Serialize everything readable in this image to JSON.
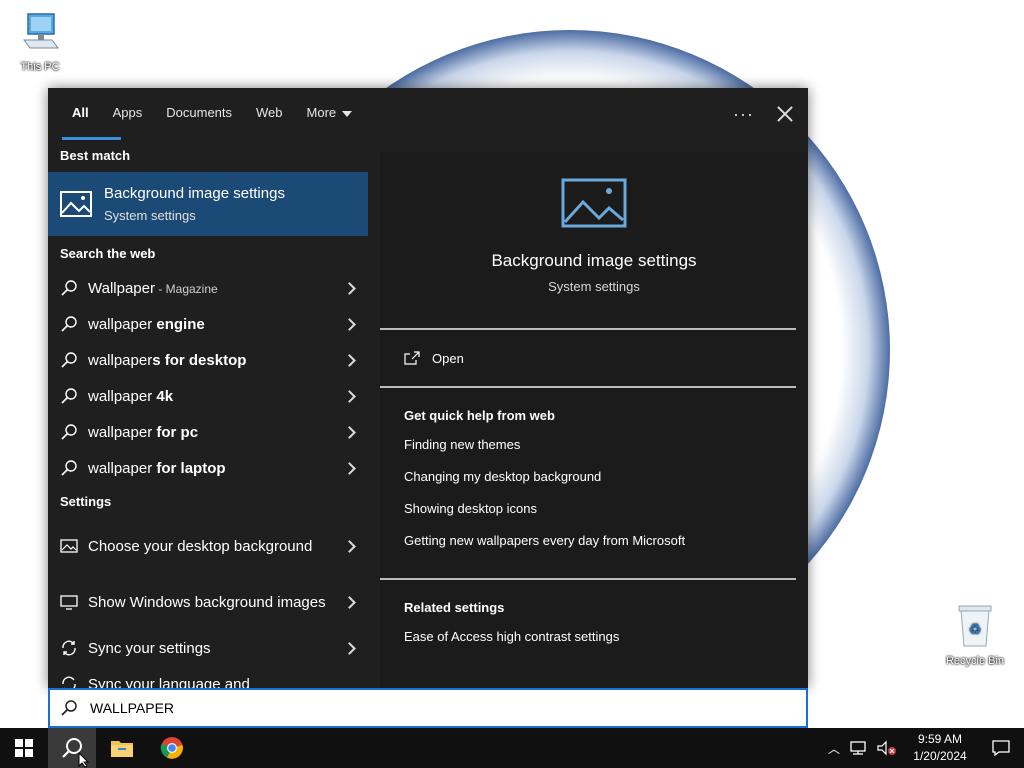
{
  "desktop": {
    "this_pc_label": "This PC",
    "recycle_bin_label": "Recycle Bin"
  },
  "search_panel": {
    "tabs": [
      "All",
      "Apps",
      "Documents",
      "Web",
      "More"
    ],
    "best_match_header": "Best match",
    "best_match": {
      "title": "Background image settings",
      "subtitle": "System settings"
    },
    "web_header": "Search the web",
    "web_results": [
      {
        "prefix": "Wallpaper",
        "bold": "",
        "sub": " - Magazine"
      },
      {
        "prefix": "wallpaper ",
        "bold": "engine",
        "sub": ""
      },
      {
        "prefix": "wallpaper",
        "bold": "s for desktop",
        "sub": ""
      },
      {
        "prefix": "wallpaper ",
        "bold": "4k",
        "sub": ""
      },
      {
        "prefix": "wallpaper ",
        "bold": "for pc",
        "sub": ""
      },
      {
        "prefix": "wallpaper ",
        "bold": "for laptop",
        "sub": ""
      }
    ],
    "settings_header": "Settings",
    "settings_results": [
      "Choose your desktop background",
      "Show Windows background images",
      "Sync your settings",
      "Sync your language and"
    ],
    "preview": {
      "title": "Background image settings",
      "subtitle": "System settings",
      "open_label": "Open",
      "quick_help_header": "Get quick help from web",
      "quick_help_links": [
        "Finding new themes",
        "Changing my desktop background",
        "Showing desktop icons",
        "Getting new wallpapers every day from Microsoft"
      ],
      "related_header": "Related settings",
      "related_links": [
        "Ease of Access high contrast settings"
      ]
    },
    "search_value": "WALLPAPER"
  },
  "taskbar": {
    "time": "9:59 AM",
    "date": "1/20/2024"
  },
  "colors": {
    "accent": "#3b8ee0",
    "selected": "#1a4a75",
    "panel": "#1f1f1f"
  }
}
